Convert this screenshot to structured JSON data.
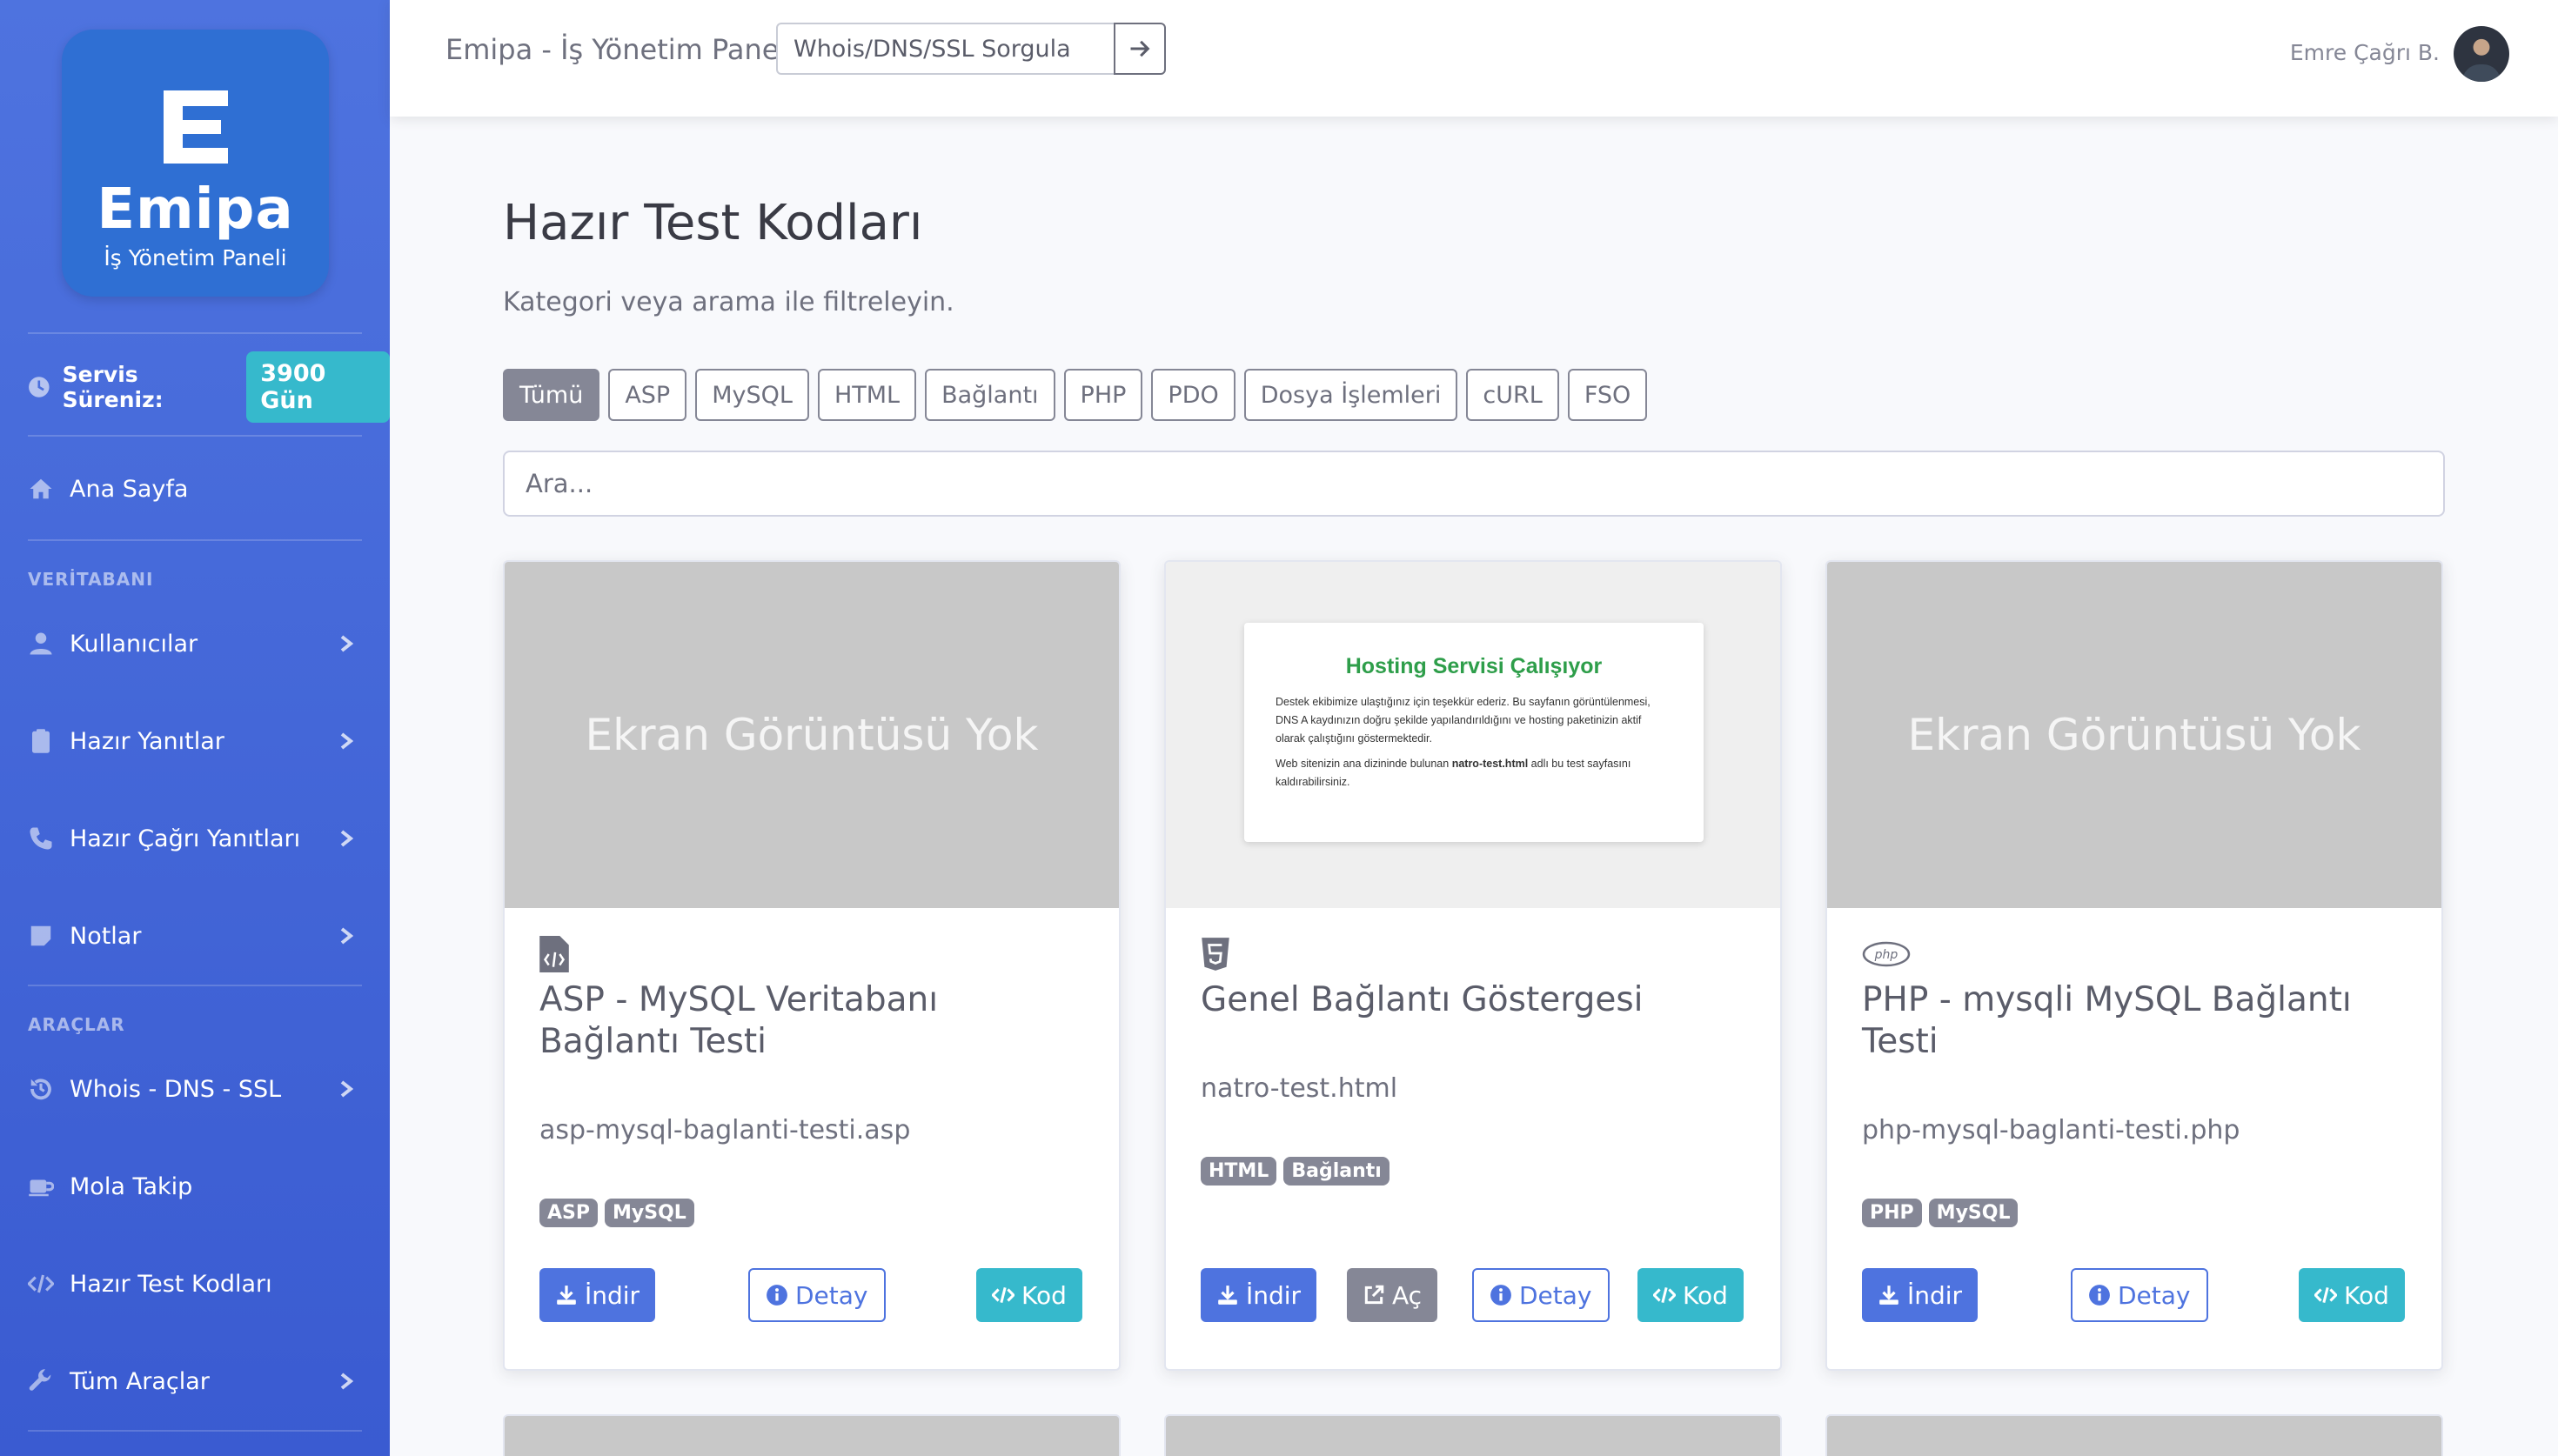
{
  "sidebar": {
    "brand_name": "Emipa",
    "brand_subtitle": "İş Yönetim Paneli",
    "service_label": "Servis Süreniz:",
    "service_value": "3900 Gün",
    "home": "Ana Sayfa",
    "heading_db": "VERİTABANI",
    "items_db": [
      "Kullanıcılar",
      "Hazır Yanıtlar",
      "Hazır Çağrı Yanıtları",
      "Notlar"
    ],
    "heading_tools": "ARAÇLAR",
    "items_tools": [
      "Whois - DNS - SSL",
      "Mola Takip",
      "Hazır Test Kodları",
      "Tüm Araçlar"
    ]
  },
  "topbar": {
    "title": "Emipa - İş Yönetim Paneli",
    "query_placeholder": "Whois/DNS/SSL Sorgula",
    "user_name": "Emre Çağrı B."
  },
  "main": {
    "title": "Hazır Test Kodları",
    "subtitle": "Kategori veya arama ile filtreleyin.",
    "filters": [
      "Tümü",
      "ASP",
      "MySQL",
      "HTML",
      "Bağlantı",
      "PHP",
      "PDO",
      "Dosya İşlemleri",
      "cURL",
      "FSO"
    ],
    "active_filter": "Tümü",
    "search_placeholder": "Ara..."
  },
  "cards": [
    {
      "no_screenshot": "Ekran Görüntüsü Yok",
      "icon": "file-code-icon",
      "title": "ASP - MySQL Veritabanı Bağlantı Testi",
      "file": "asp-mysql-baglanti-testi.asp",
      "tags": [
        "ASP",
        "MySQL"
      ],
      "download": "İndir",
      "detail": "Detay",
      "code": "Kod"
    },
    {
      "preview_title": "Hosting Servisi Çalışıyor",
      "preview_p1": "Destek ekibimize ulaştığınız için teşekkür ederiz. Bu sayfanın görüntülenmesi, DNS A kaydınızın doğru şekilde yapılandırıldığını ve hosting paketinizin aktif olarak çalıştığını göstermektedir.",
      "preview_p2_pre": "Web sitenizin ana dizininde bulunan ",
      "preview_p2_bold": "natro-test.html",
      "preview_p2_post": " adlı bu test sayfasını kaldırabilirsiniz.",
      "icon": "html5-icon",
      "title": "Genel Bağlantı Göstergesi",
      "file": "natro-test.html",
      "tags": [
        "HTML",
        "Bağlantı"
      ],
      "download": "İndir",
      "open": "Aç",
      "detail": "Detay",
      "code": "Kod"
    },
    {
      "no_screenshot": "Ekran Görüntüsü Yok",
      "icon": "php-icon",
      "icon_text": "php",
      "title": "PHP - mysqli MySQL Bağlantı Testi",
      "file": "php-mysql-baglanti-testi.php",
      "tags": [
        "PHP",
        "MySQL"
      ],
      "download": "İndir",
      "detail": "Detay",
      "code": "Kod"
    }
  ],
  "colors": {
    "sidebar": "#4e73df",
    "primary": "#4e73df",
    "info": "#36b9cc",
    "secondary": "#858796"
  }
}
